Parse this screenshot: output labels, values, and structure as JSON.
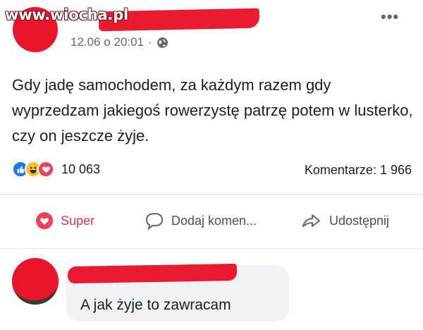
{
  "watermark": "www.wiocha.pl",
  "post": {
    "timestamp": "12.06 o 20:01",
    "separator": "·",
    "audience_icon": "globe-icon",
    "more_icon": "•••",
    "text": "Gdy jadę samochodem, za każdym razem gdy wyprzedzam jakiegoś rowerzystę patrzę potem w lusterko, czy on jeszcze żyje.",
    "reactions": {
      "icons": [
        "like-icon",
        "haha-icon",
        "love-icon"
      ],
      "count": "10 063"
    },
    "comments_count": "Komentarze: 1 966"
  },
  "actions": {
    "react_label": "Super",
    "comment_label": "Dodaj komen...",
    "share_label": "Udostępnij"
  },
  "comment": {
    "text": "A jak żyje to zawracam"
  },
  "colors": {
    "redaction": "#e8152b",
    "like": "#1877f2",
    "love": "#f33e58",
    "haha": "#f7c02b",
    "super_active": "#e4324f",
    "meta_text": "#65676b"
  }
}
